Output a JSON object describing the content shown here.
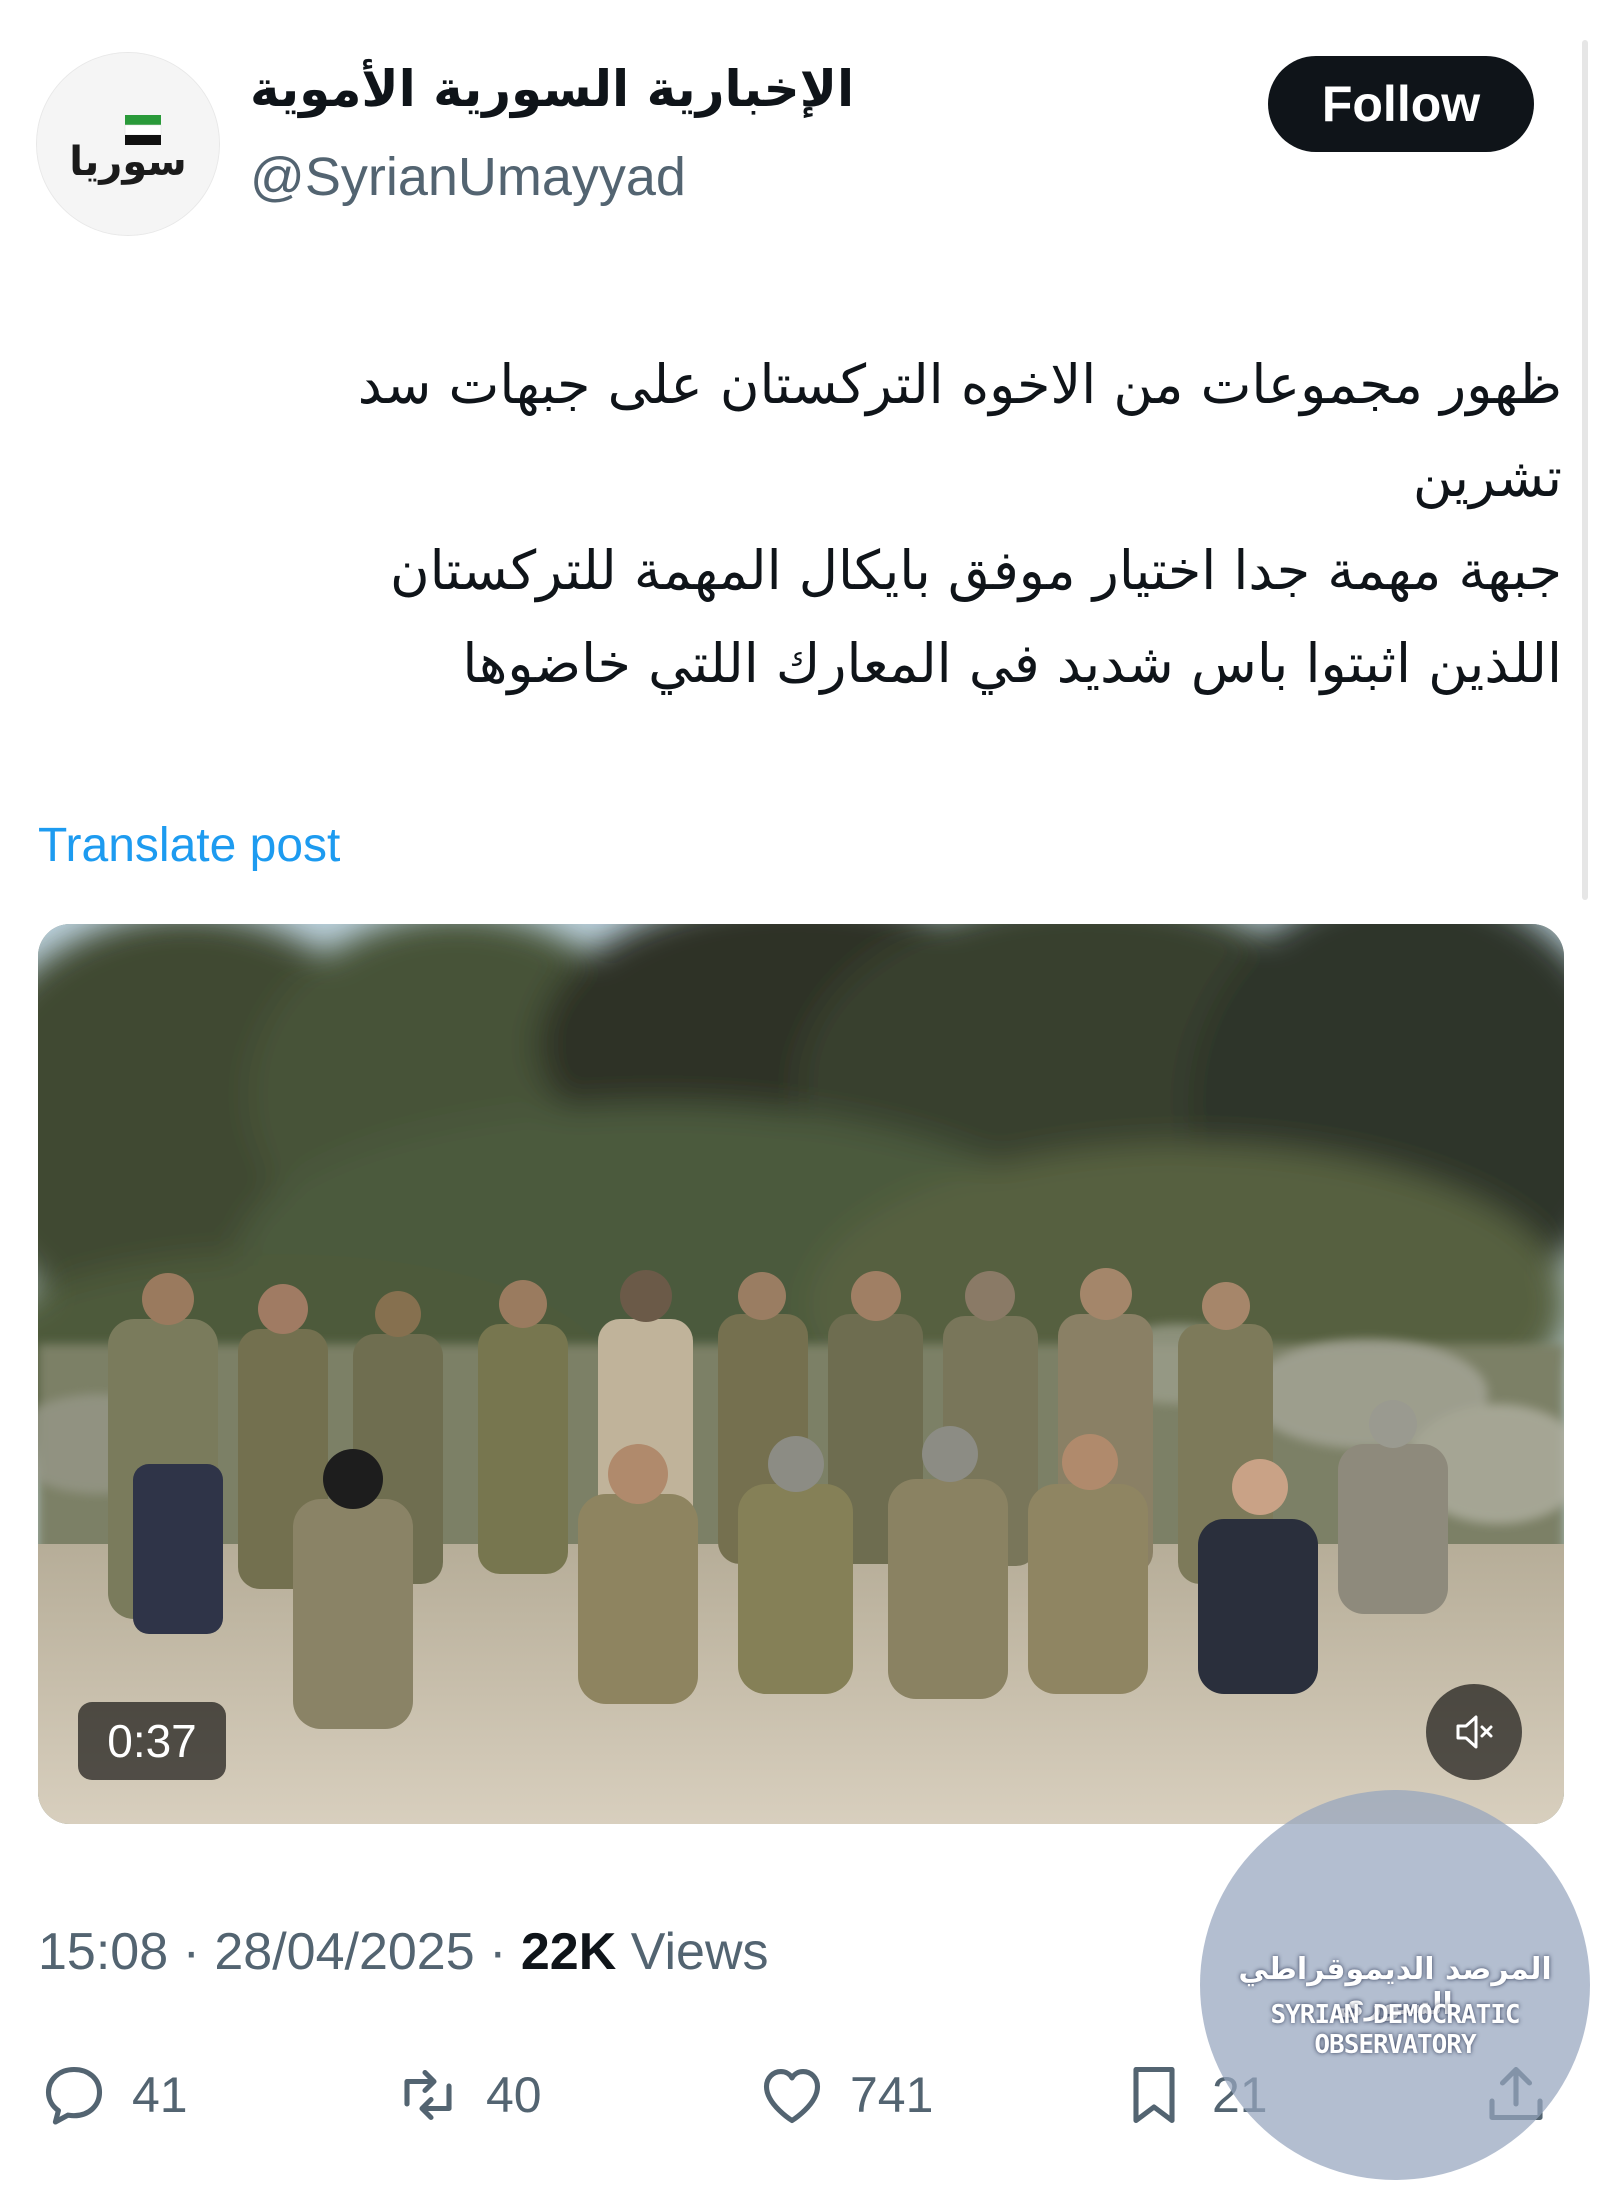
{
  "account": {
    "avatar_text": "سوريا",
    "display_name": "الإخبارية السورية الأموية",
    "handle": "@SyrianUmayyad",
    "follow_label": "Follow"
  },
  "post": {
    "lines": [
      "ظهور مجموعات من الاخوه التركستان على جبهات سد",
      "تشرين",
      "جبهة مهمة جدا اختيار موفق بايكال المهمة للتركستان",
      "اللذين اثبتوا باس شديد في المعارك اللتي خاضوها"
    ],
    "translate_label": "Translate post"
  },
  "media": {
    "duration": "0:37",
    "mute_icon": "speaker-muted-icon"
  },
  "meta": {
    "time": "15:08",
    "date": "28/04/2025",
    "separator": "·",
    "views_count": "22K",
    "views_label": "Views"
  },
  "actions": {
    "replies": "41",
    "reposts": "40",
    "likes": "741",
    "bookmarks": "21"
  },
  "watermark": {
    "arabic": "المرصد الديموقراطي السوري",
    "english": "SYRIAN DEMOCRATIC OBSERVATORY"
  },
  "colors": {
    "link": "#1d9bf0",
    "secondary_text": "#536471",
    "primary_text": "#0f1419"
  }
}
